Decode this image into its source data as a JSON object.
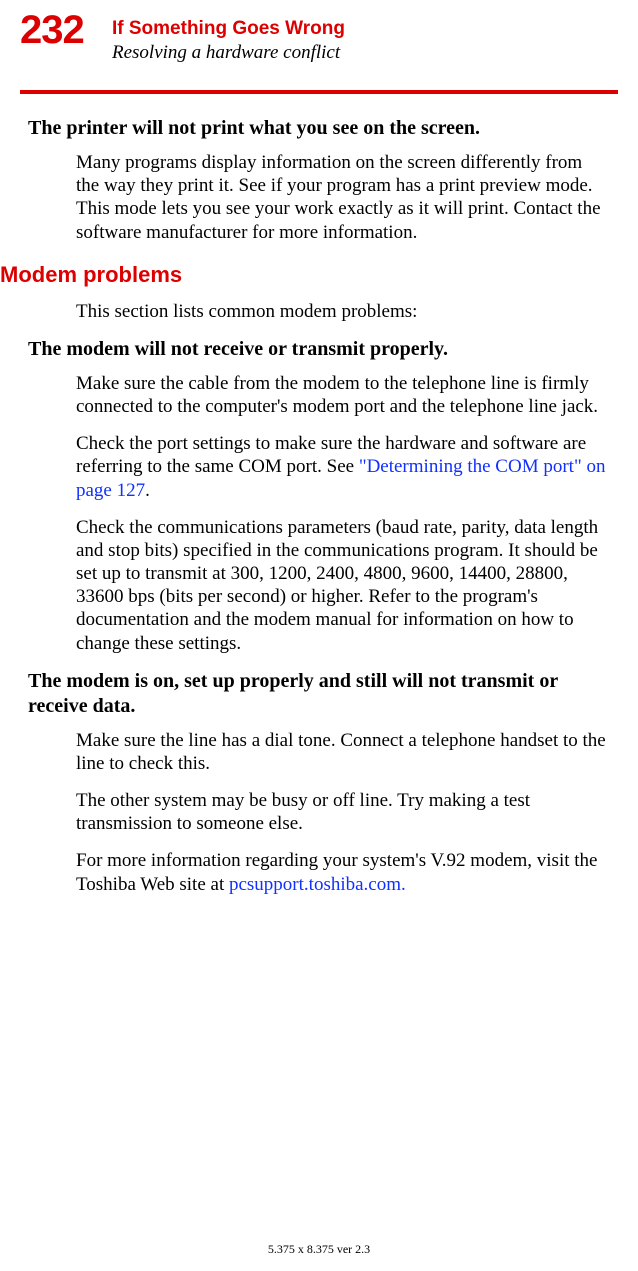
{
  "header": {
    "page_number": "232",
    "title": "If Something Goes Wrong",
    "subtitle": "Resolving a hardware conflict"
  },
  "body": {
    "h1": "The printer will not print what you see on the screen.",
    "p1": "Many programs display information on the screen differently from the way they print it. See if your program has a print preview mode. This mode lets you see your work exactly as it will print. Contact the software manufacturer for more information.",
    "section1": "Modem problems",
    "p2": "This section lists common modem problems:",
    "h2": "The modem will not receive or transmit properly.",
    "p3": "Make sure the cable from the modem to the telephone line is firmly connected to the computer's modem port and the telephone line jack.",
    "p4a": "Check the port settings to make sure the hardware and software are referring to the same COM port. See ",
    "p4link": "\"Determining the COM port\" on page 127",
    "p4b": ".",
    "p5": "Check the communications parameters (baud rate, parity, data length and stop bits) specified in the communications program. It should be set up to transmit at 300, 1200, 2400, 4800, 9600, 14400, 28800, 33600 bps (bits per second) or higher. Refer to the program's documentation and the modem manual for information on how to change these settings.",
    "h3": "The modem is on, set up properly and still will not transmit or receive data.",
    "p6": "Make sure the line has a dial tone. Connect a telephone handset to the line to check this.",
    "p7": "The other system may be busy or off line. Try making a test transmission to someone else.",
    "p8a": "For more information regarding your system's V.92 modem, visit the Toshiba Web site at ",
    "p8link": "pcsupport.toshiba.com."
  },
  "footer": {
    "text": "5.375 x 8.375 ver 2.3"
  }
}
